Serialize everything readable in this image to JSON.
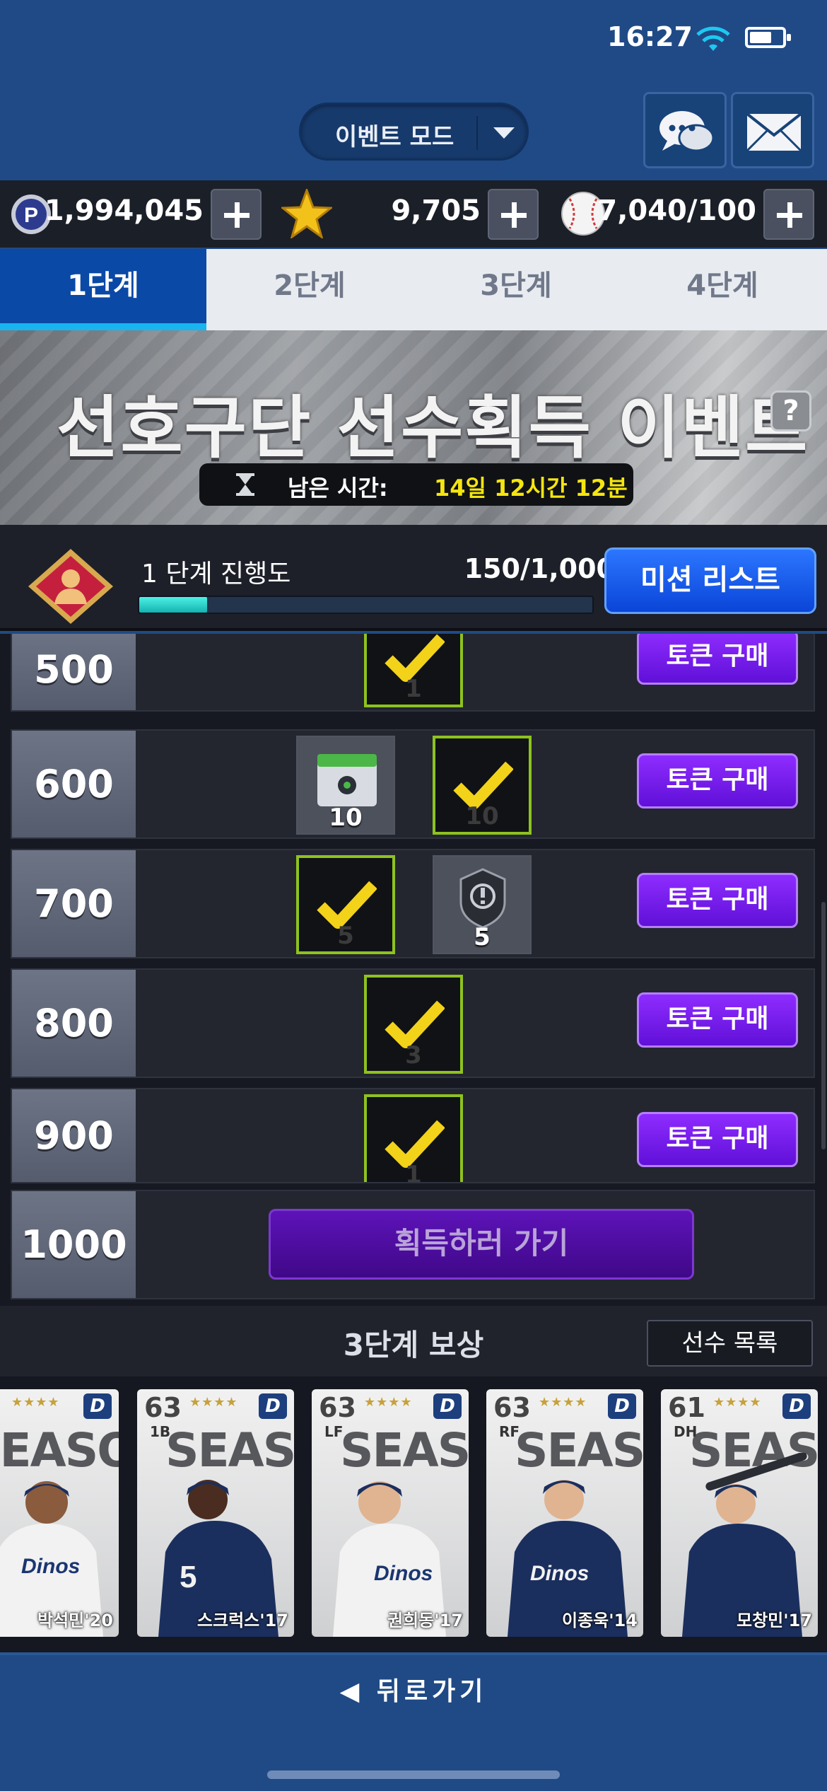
{
  "status_bar": {
    "time": "16:27"
  },
  "header": {
    "mode_label": "이벤트 모드"
  },
  "currency": {
    "points": "1,994,045",
    "stars": "9,705",
    "balls": "7,040/100"
  },
  "tabs": [
    {
      "label": "1단계",
      "active": true
    },
    {
      "label": "2단계",
      "active": false
    },
    {
      "label": "3단계",
      "active": false
    },
    {
      "label": "4단계",
      "active": false
    }
  ],
  "banner": {
    "title": "선호구단 선수획득 이벤트",
    "help": "?",
    "timer_label": "남은 시간:",
    "timer_value": "14일 12시간 12분"
  },
  "progress": {
    "label": "1 단계 진행도",
    "value": "150/1,000",
    "fraction": 0.15,
    "mission_button": "미션 리스트"
  },
  "rows": [
    {
      "score": "500",
      "button": "토큰 구매",
      "rewards": [
        {
          "qty": "1",
          "claimed": true
        }
      ]
    },
    {
      "score": "600",
      "button": "토큰 구매",
      "rewards": [
        {
          "qty": "10",
          "claimed": false,
          "icon": "battery-pack-icon"
        },
        {
          "qty": "10",
          "claimed": true
        }
      ]
    },
    {
      "score": "700",
      "button": "토큰 구매",
      "rewards": [
        {
          "qty": "5",
          "claimed": true
        },
        {
          "qty": "5",
          "claimed": false,
          "icon": "emblem-icon"
        }
      ]
    },
    {
      "score": "800",
      "button": "토큰 구매",
      "rewards": [
        {
          "qty": "3",
          "claimed": true
        }
      ]
    },
    {
      "score": "900",
      "button": "토큰 구매",
      "rewards": [
        {
          "qty": "1",
          "claimed": true
        }
      ]
    },
    {
      "score": "1000",
      "button": "획득하러 가기"
    }
  ],
  "rewards_section": {
    "title": "3단계 보상",
    "player_list_button": "선수 목록"
  },
  "cards": [
    {
      "ovr": "",
      "pos": "",
      "name": "박석민'20",
      "season_text": "SEASON",
      "uniform": "white"
    },
    {
      "ovr": "63",
      "pos": "1B",
      "name": "스크럭스'17",
      "season_text": "SEASON",
      "uniform": "navy"
    },
    {
      "ovr": "63",
      "pos": "LF",
      "name": "권희동'17",
      "season_text": "SEASON",
      "uniform": "white"
    },
    {
      "ovr": "63",
      "pos": "RF",
      "name": "이종욱'14",
      "season_text": "SEASON",
      "uniform": "navy"
    },
    {
      "ovr": "61",
      "pos": "DH",
      "name": "모창민'17",
      "season_text": "SEASON",
      "uniform": "navy"
    }
  ],
  "footer": {
    "back_label": "뒤로가기"
  },
  "colors": {
    "header_bg": "#1f4a86",
    "tab_active": "#0a49a5",
    "token_button": "#7a1ff0",
    "mission_button": "#1257e8",
    "claimed_border": "#8ec21f",
    "timer_value": "#f5e50f"
  }
}
